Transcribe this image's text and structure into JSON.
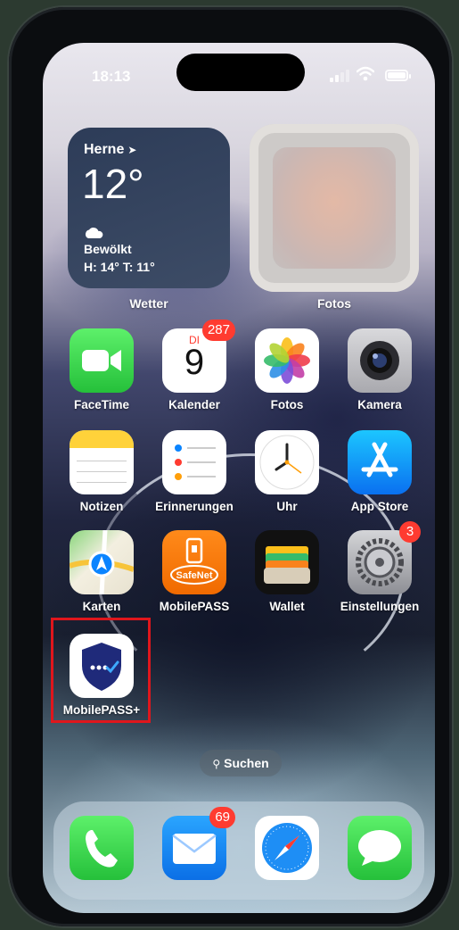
{
  "status_bar": {
    "time": "18:13",
    "signal_icon": "cellular-signal-icon",
    "wifi_icon": "wifi-icon",
    "battery_icon": "battery-icon"
  },
  "widgets": {
    "weather": {
      "city": "Herne",
      "location_icon": "location-arrow-icon",
      "temperature": "12°",
      "condition_icon": "cloud-icon",
      "condition": "Bewölkt",
      "high_low": "H: 14° T: 11°",
      "label": "Wetter"
    },
    "photos": {
      "label": "Fotos"
    }
  },
  "apps": {
    "row1": [
      {
        "label": "FaceTime",
        "icon": "facetime-icon"
      },
      {
        "label": "Kalender",
        "icon": "calendar-icon",
        "badge": "287",
        "weekday": "DI",
        "day": "9"
      },
      {
        "label": "Fotos",
        "icon": "photos-icon"
      },
      {
        "label": "Kamera",
        "icon": "camera-icon"
      }
    ],
    "row2": [
      {
        "label": "Notizen",
        "icon": "notes-icon"
      },
      {
        "label": "Erinnerungen",
        "icon": "reminders-icon"
      },
      {
        "label": "Uhr",
        "icon": "clock-icon"
      },
      {
        "label": "App Store",
        "icon": "app-store-icon"
      }
    ],
    "row3": [
      {
        "label": "Karten",
        "icon": "maps-icon"
      },
      {
        "label": "MobilePASS",
        "icon": "safenet-icon",
        "brand": "SafeNet"
      },
      {
        "label": "Wallet",
        "icon": "wallet-icon"
      },
      {
        "label": "Einstellungen",
        "icon": "settings-icon",
        "badge": "3"
      }
    ],
    "row4": [
      {
        "label": "MobilePASS+",
        "icon": "mobilepass-plus-shield-icon",
        "highlighted": true
      }
    ]
  },
  "search": {
    "label": "Suchen",
    "icon": "search-icon"
  },
  "dock": [
    {
      "name": "phone",
      "icon": "phone-icon"
    },
    {
      "name": "mail",
      "icon": "mail-icon",
      "badge": "69"
    },
    {
      "name": "safari",
      "icon": "safari-compass-icon"
    },
    {
      "name": "messages",
      "icon": "messages-icon"
    }
  ],
  "colors": {
    "badge": "#ff3b30",
    "highlight_border": "#e0161c"
  }
}
